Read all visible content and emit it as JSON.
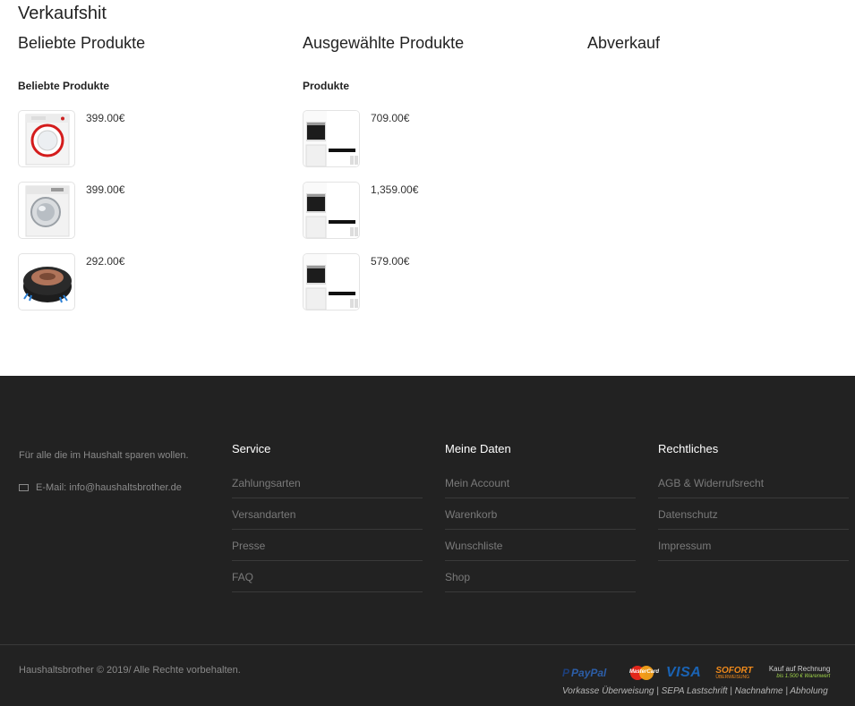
{
  "page": {
    "section_title": "Verkaufshit"
  },
  "columns": [
    {
      "title": "Beliebte Produkte",
      "subtitle": "Beliebte Produkte",
      "products": [
        {
          "price": "399.00€",
          "image": "washing-machine-red-door"
        },
        {
          "price": "399.00€",
          "image": "washing-machine-silver-door"
        },
        {
          "price": "292.00€",
          "image": "robot-vacuum"
        }
      ]
    },
    {
      "title": "Ausgewählte Produkte",
      "subtitle": "Produkte",
      "products": [
        {
          "price": "709.00€",
          "image": "built-in-oven-set"
        },
        {
          "price": "1,359.00€",
          "image": "built-in-oven-set"
        },
        {
          "price": "579.00€",
          "image": "built-in-oven-set"
        }
      ]
    },
    {
      "title": "Abverkauf",
      "subtitle": "",
      "products": []
    }
  ],
  "footer": {
    "about": "Für alle die im Haushalt sparen wollen.",
    "email": "E-Mail: info@haushaltsbrother.de",
    "email_icon": "envelope-icon",
    "columns": [
      {
        "title": "Service",
        "links": [
          "Zahlungsarten",
          "Versandarten",
          "Presse",
          "FAQ"
        ]
      },
      {
        "title": "Meine Daten",
        "links": [
          "Mein Account",
          "Warenkorb",
          "Wunschliste",
          "Shop"
        ]
      },
      {
        "title": "Rechtliches",
        "links": [
          "AGB & Widerrufsrecht",
          "Datenschutz",
          "Impressum"
        ]
      }
    ],
    "copyright": "Haushaltsbrother © 2019/ Alle Rechte vorbehalten.",
    "payment": {
      "paypal": "PayPal",
      "mastercard": "MasterCard",
      "visa": "VISA",
      "sofort": "SOFORT",
      "sofort_sub": "ÜBERWEISUNG",
      "rechnung": "Kauf auf Rechnung",
      "rechnung_sub": "bis 1.500 € Warenwert",
      "methods": "Vorkasse Überweisung  |  SEPA Lastschrift  |  Nachnahme  |  Abholung"
    }
  },
  "colors": {
    "footer_bg": "#222222",
    "footer_text": "#8a8a8a",
    "footer_link": "#7a7a7a",
    "heading": "#222222"
  }
}
